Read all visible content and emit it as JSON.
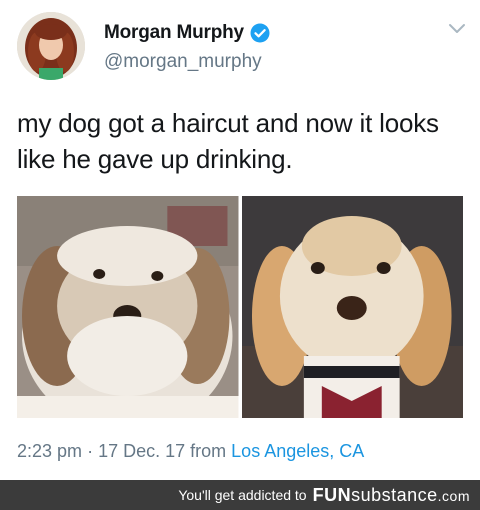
{
  "tweet": {
    "display_name": "Morgan Murphy",
    "handle": "@morgan_murphy",
    "verified_icon": "verified-badge-icon",
    "menu_icon": "chevron-down-icon",
    "text": "my dog got a haircut and now it looks like he gave up drinking.",
    "time": "2:23 pm",
    "date": "17 Dec. 17",
    "from_label": "from",
    "location": "Los Angeles, CA",
    "separator": "·"
  },
  "colors": {
    "name": "#14171a",
    "secondary": "#657786",
    "link": "#1b95e0",
    "banner_bg": "#3b3b3b"
  },
  "banner": {
    "tagline": "You'll get addicted to",
    "brand_prefix": "FUN",
    "brand_suffix": "substance",
    "brand_tld": ".com"
  }
}
